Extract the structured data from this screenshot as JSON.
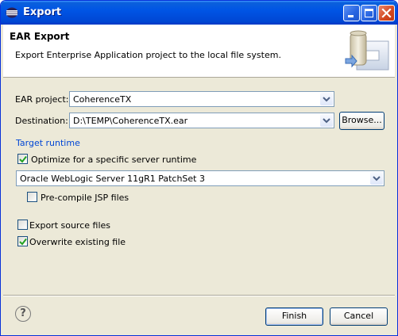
{
  "window": {
    "title": "Export"
  },
  "header": {
    "title": "EAR Export",
    "description": "Export Enterprise Application project to the local file system."
  },
  "form": {
    "ear_project": {
      "label": "EAR project:",
      "value": "CoherenceTX"
    },
    "destination": {
      "label": "Destination:",
      "value": "D:\\TEMP\\CoherenceTX.ear"
    },
    "browse_label": "Browse...",
    "target_runtime_label": "Target runtime",
    "optimize": {
      "label": "Optimize for a specific server runtime",
      "checked": true
    },
    "runtime": {
      "value": "Oracle WebLogic Server 11gR1 PatchSet 3"
    },
    "precompile_jsp": {
      "label": "Pre-compile JSP files",
      "checked": false
    },
    "export_source": {
      "label": "Export source files",
      "checked": false
    },
    "overwrite": {
      "label": "Overwrite existing file",
      "checked": true
    }
  },
  "footer": {
    "finish_label": "Finish",
    "cancel_label": "Cancel"
  },
  "icons": {
    "app": "eclipse-icon",
    "help": "help-icon",
    "header": "ear-export-wizard-graphic"
  },
  "colors": {
    "titlebar": "#0055e5",
    "dialog_bg": "#ece9d8",
    "link": "#0046d5",
    "check": "#21a121"
  }
}
